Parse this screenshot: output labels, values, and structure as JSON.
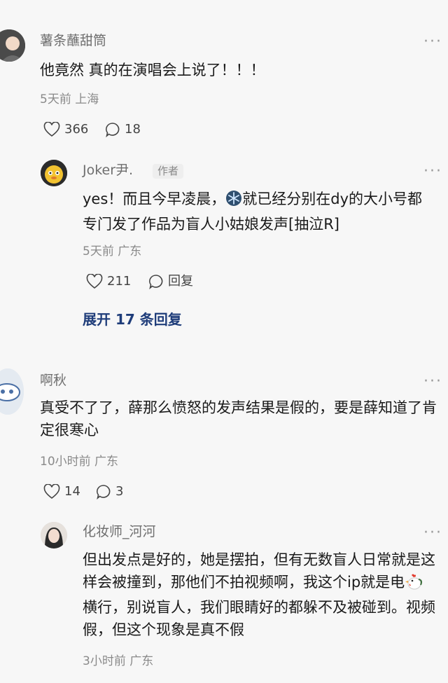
{
  "comments": [
    {
      "username": "薯条蘸甜筒",
      "text": "他竟然 真的在演唱会上说了！！！",
      "meta": "5天前 上海",
      "likes": "366",
      "replies": "18",
      "more": "···"
    },
    {
      "username": "Joker尹.",
      "badge": "作者",
      "text_part1": "yes！而且今早凌晨，",
      "text_part2": "就已经分别在dy的大小号都专门发了作品为盲人小姑娘发声[抽泣R]",
      "meta": "5天前 广东",
      "likes": "211",
      "reply_label": "回复",
      "more": "···"
    },
    {
      "expand_label": "展开 17 条回复"
    },
    {
      "username": "啊秋",
      "text": "真受不了了，薛那么愤怒的发声结果是假的，要是薛知道了肯定很寒心",
      "meta": "10小时前 广东",
      "likes": "14",
      "replies": "3",
      "more": "···"
    },
    {
      "username": "化妆师_河河",
      "text_part1": "但出发点是好的，她是摆拍，但有无数盲人日常就是这样会被撞到，那他们不拍视频啊，我这个ip就是电",
      "text_part2": "横行，别说盲人，我们眼睛好的都躲不及被碰到。视频假，但这个现象是真不假",
      "meta": "3小时前 广东",
      "more": "···"
    }
  ],
  "colors": {
    "background": "#f7f7f7",
    "expand_link": "#1f3d7a",
    "meta_text": "#8a8a8a"
  }
}
